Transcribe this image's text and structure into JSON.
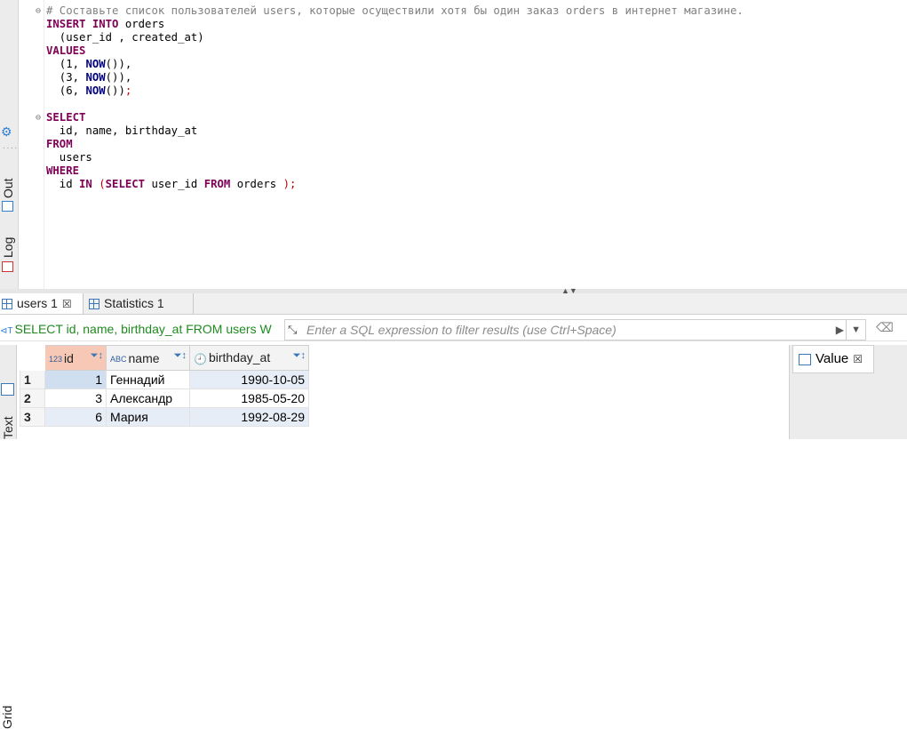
{
  "side": {
    "out_label": "Out",
    "log_label": "Log"
  },
  "editor": {
    "comment": "# Составьте список пользователей users, которые осуществили хотя бы один заказ orders в интернет магазине.",
    "l2_kw": "INSERT INTO",
    "l2_rest": " orders",
    "l3": "  (user_id , created_at)",
    "l4_kw": "VALUES",
    "values_rows": [
      {
        "open": "  (",
        "num": "1",
        "sep": ", ",
        "fn": "NOW",
        "close": "()),",
        "semi": ""
      },
      {
        "open": "  (",
        "num": "3",
        "sep": ", ",
        "fn": "NOW",
        "close": "()),",
        "semi": ""
      },
      {
        "open": "  (",
        "num": "6",
        "sep": ", ",
        "fn": "NOW",
        "close": "())",
        "semi": ";"
      }
    ],
    "select_kw": "SELECT",
    "select_cols": "  id, name, birthday_at",
    "from_kw": "FROM",
    "from_table": "  users",
    "where_kw": "WHERE",
    "where_a": "  id ",
    "where_in": "IN",
    "where_paren": " (",
    "where_select": "SELECT",
    "where_col": " user_id ",
    "where_from": "FROM",
    "where_tbl": " orders ",
    "where_close": ")",
    "where_semi": ";"
  },
  "tabs": [
    {
      "label": "users 1",
      "close": "☒"
    },
    {
      "label": "Statistics 1"
    }
  ],
  "filter": {
    "sql": "SELECT id, name, birthday_at FROM users W",
    "placeholder": "Enter a SQL expression to filter results (use Ctrl+Space)"
  },
  "result_side": {
    "grid_label": "Grid",
    "text_label": "Text"
  },
  "table": {
    "columns": [
      {
        "name": "id",
        "type_icon": "123"
      },
      {
        "name": "name",
        "type_icon": "ABC"
      },
      {
        "name": "birthday_at",
        "type_icon": "clock-icon"
      }
    ],
    "rows": [
      {
        "n": "1",
        "id": "1",
        "name": "Геннадий",
        "birthday_at": "1990-10-05"
      },
      {
        "n": "2",
        "id": "3",
        "name": "Александр",
        "birthday_at": "1985-05-20"
      },
      {
        "n": "3",
        "id": "6",
        "name": "Мария",
        "birthday_at": "1992-08-29"
      }
    ]
  },
  "value_panel": {
    "label": "Value",
    "close": "☒"
  }
}
